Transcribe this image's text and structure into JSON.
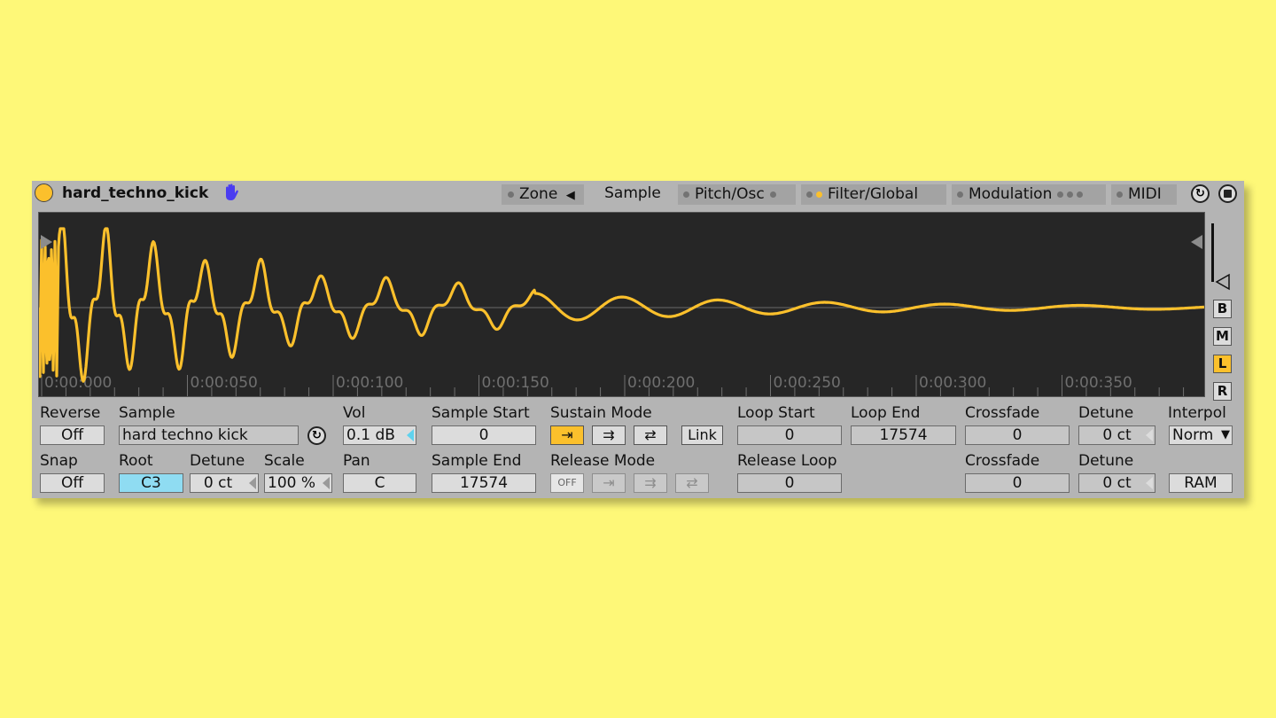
{
  "header": {
    "title": "hard_techno_kick",
    "tabs": [
      {
        "label": "Zone",
        "state": "inactive"
      },
      {
        "label": "Sample",
        "state": "active"
      },
      {
        "label": "Pitch/Osc",
        "state": "inactive"
      },
      {
        "label": "Filter/Global",
        "state": "inactive"
      },
      {
        "label": "Modulation",
        "state": "inactive"
      },
      {
        "label": "MIDI",
        "state": "inactive"
      }
    ]
  },
  "waveform": {
    "color": "#fbc02c",
    "background": "#262626",
    "time_labels": [
      "0:00:000",
      "0:00:050",
      "0:00:100",
      "0:00:150",
      "0:00:200",
      "0:00:250",
      "0:00:300",
      "0:00:350"
    ]
  },
  "side_buttons": [
    {
      "label": "B",
      "active": false
    },
    {
      "label": "M",
      "active": false
    },
    {
      "label": "L",
      "active": true
    },
    {
      "label": "R",
      "active": false
    }
  ],
  "controls": {
    "reverse": {
      "label": "Reverse",
      "value": "Off"
    },
    "snap": {
      "label": "Snap",
      "value": "Off"
    },
    "sample": {
      "label": "Sample",
      "value": "hard techno kick"
    },
    "root": {
      "label": "Root",
      "value": "C3"
    },
    "detune1": {
      "label": "Detune",
      "value": "0 ct"
    },
    "scale": {
      "label": "Scale",
      "value": "100 %"
    },
    "vol": {
      "label": "Vol",
      "value": "0.1 dB"
    },
    "pan": {
      "label": "Pan",
      "value": "C"
    },
    "sample_start": {
      "label": "Sample Start",
      "value": "0"
    },
    "sample_end": {
      "label": "Sample End",
      "value": "17574"
    },
    "sustain_mode": {
      "label": "Sustain Mode",
      "link": "Link"
    },
    "release_mode": {
      "label": "Release Mode",
      "off": "OFF"
    },
    "loop_start": {
      "label": "Loop Start",
      "value": "0"
    },
    "loop_end": {
      "label": "Loop End",
      "value": "17574"
    },
    "release_loop": {
      "label": "Release Loop",
      "value": "0"
    },
    "crossfade1": {
      "label": "Crossfade",
      "value": "0"
    },
    "crossfade2": {
      "label": "Crossfade",
      "value": "0"
    },
    "detune2": {
      "label": "Detune",
      "value": "0 ct"
    },
    "detune3": {
      "label": "Detune",
      "value": "0 ct"
    },
    "interpol": {
      "label": "Interpol",
      "value": "Norm"
    },
    "ram": {
      "label": "RAM"
    }
  },
  "colors": {
    "accent": "#fbc02c",
    "background": "#fef878",
    "panel": "#b4b4b4",
    "root_field": "#8fdcf2"
  }
}
